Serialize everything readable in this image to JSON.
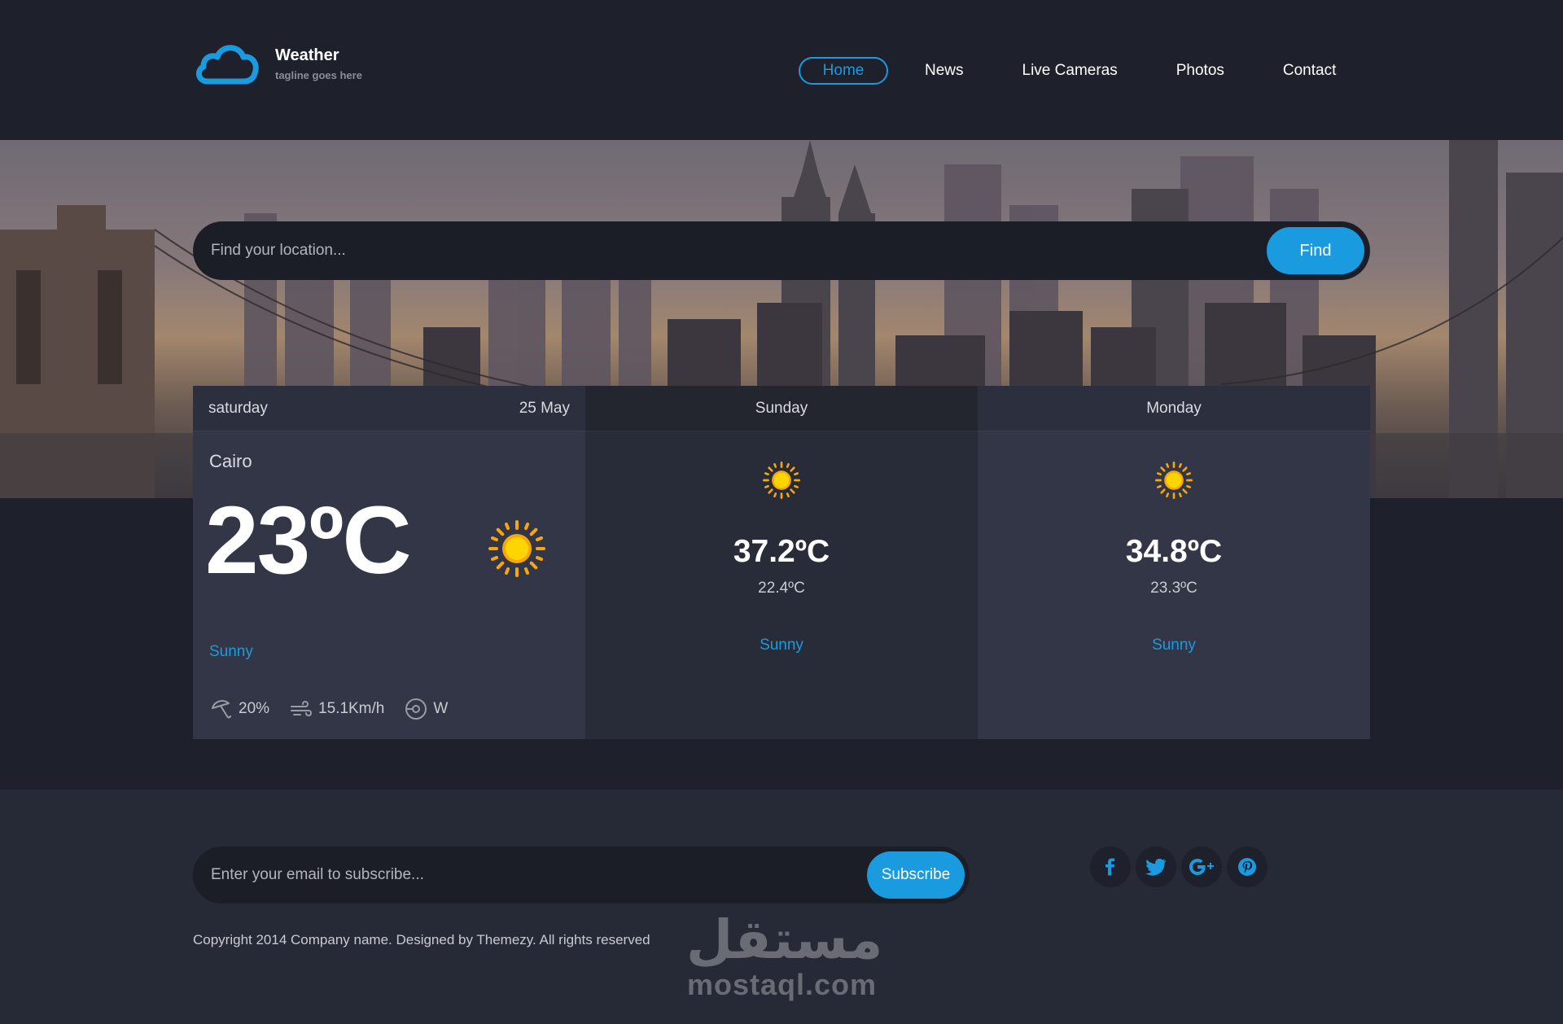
{
  "colors": {
    "accent": "#1a9be0",
    "background": "#1e202b",
    "card": "#323646"
  },
  "brand": {
    "title": "Weather",
    "tagline": "tagline goes here",
    "icon": "cloud-icon"
  },
  "nav": {
    "items": [
      {
        "label": "Home",
        "active": true
      },
      {
        "label": "News"
      },
      {
        "label": "Live Cameras"
      },
      {
        "label": "Photos"
      },
      {
        "label": "Contact"
      }
    ]
  },
  "search": {
    "placeholder": "Find your location...",
    "button": "Find"
  },
  "forecast": {
    "today": {
      "day": "saturday",
      "date": "25 May",
      "location": "Cairo",
      "temperature": "23ºC",
      "icon": "sun-icon",
      "condition": "Sunny",
      "humidity": "20%",
      "wind_speed": "15.1Km/h",
      "wind_direction": "W"
    },
    "days": [
      {
        "day": "Sunday",
        "icon": "sun-icon",
        "max": "37.2ºC",
        "min": "22.4ºC",
        "condition": "Sunny"
      },
      {
        "day": "Monday",
        "icon": "sun-icon",
        "max": "34.8ºC",
        "min": "23.3ºC",
        "condition": "Sunny"
      }
    ]
  },
  "footer": {
    "subscribe_placeholder": "Enter your email to subscribe...",
    "subscribe_button": "Subscribe",
    "socials": [
      "facebook-icon",
      "twitter-icon",
      "google-plus-icon",
      "pinterest-icon"
    ],
    "copyright": "Copyright 2014 Company name. Designed by Themezy. All rights reserved"
  },
  "watermark": {
    "arabic": "مستقل",
    "latin": "mostaql.com"
  }
}
